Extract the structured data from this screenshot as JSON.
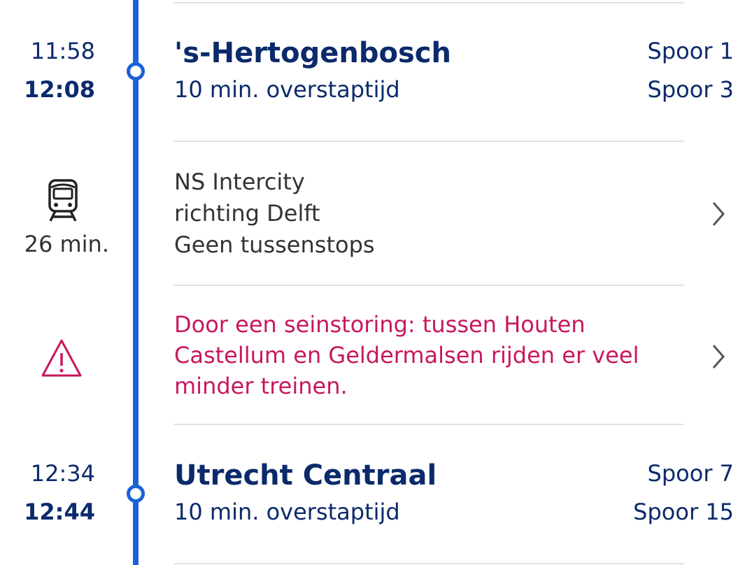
{
  "stops": [
    {
      "planned_time": "11:58",
      "actual_time": "12:08",
      "station": "'s-Hertogenbosch",
      "transfer": "10 min. overstaptijd",
      "arrival_platform": "Spoor 1",
      "departure_platform": "Spoor 3"
    },
    {
      "planned_time": "12:34",
      "actual_time": "12:44",
      "station": "Utrecht Centraal",
      "transfer": "10 min. overstaptijd",
      "arrival_platform": "Spoor 7",
      "departure_platform": "Spoor 15"
    }
  ],
  "leg": {
    "icon": "train-icon",
    "duration": "26 min.",
    "lines": [
      "NS Intercity",
      "richting Delft",
      "Geen tussenstops"
    ]
  },
  "disruption": {
    "icon": "warning-icon",
    "message": "Door een seinstoring: tussen Houten Castellum en Geldermalsen rijden er veel minder treinen."
  },
  "colors": {
    "timeline": "#1a62d6",
    "text_primary": "#0b2a6b",
    "warning": "#c8175e",
    "divider": "#e2e2e2"
  }
}
